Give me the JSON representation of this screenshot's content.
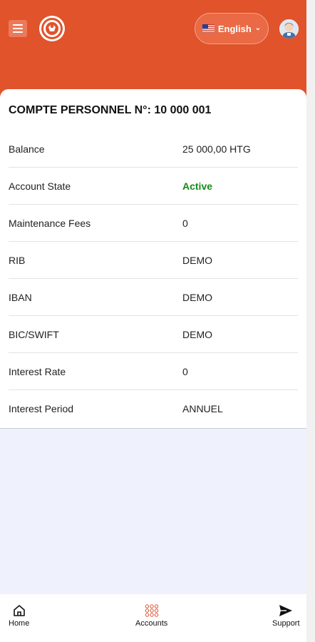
{
  "header": {
    "language": "English",
    "flag_icon": "us-flag-icon",
    "background_color": "#e0532b"
  },
  "account": {
    "title": "COMPTE PERSONNEL N°: 10 000 001",
    "rows": [
      {
        "label": "Balance",
        "value": "25 000,00 HTG"
      },
      {
        "label": "Account State",
        "value": "Active",
        "status_color": "#148a1a"
      },
      {
        "label": "Maintenance Fees",
        "value": "0"
      },
      {
        "label": "RIB",
        "value": "DEMO"
      },
      {
        "label": "IBAN",
        "value": "DEMO"
      },
      {
        "label": "BIC/SWIFT",
        "value": "DEMO"
      },
      {
        "label": "Interest Rate",
        "value": "0"
      },
      {
        "label": "Interest Period",
        "value": "ANNUEL"
      }
    ]
  },
  "nav": {
    "home": "Home",
    "accounts": "Accounts",
    "support": "Support"
  }
}
